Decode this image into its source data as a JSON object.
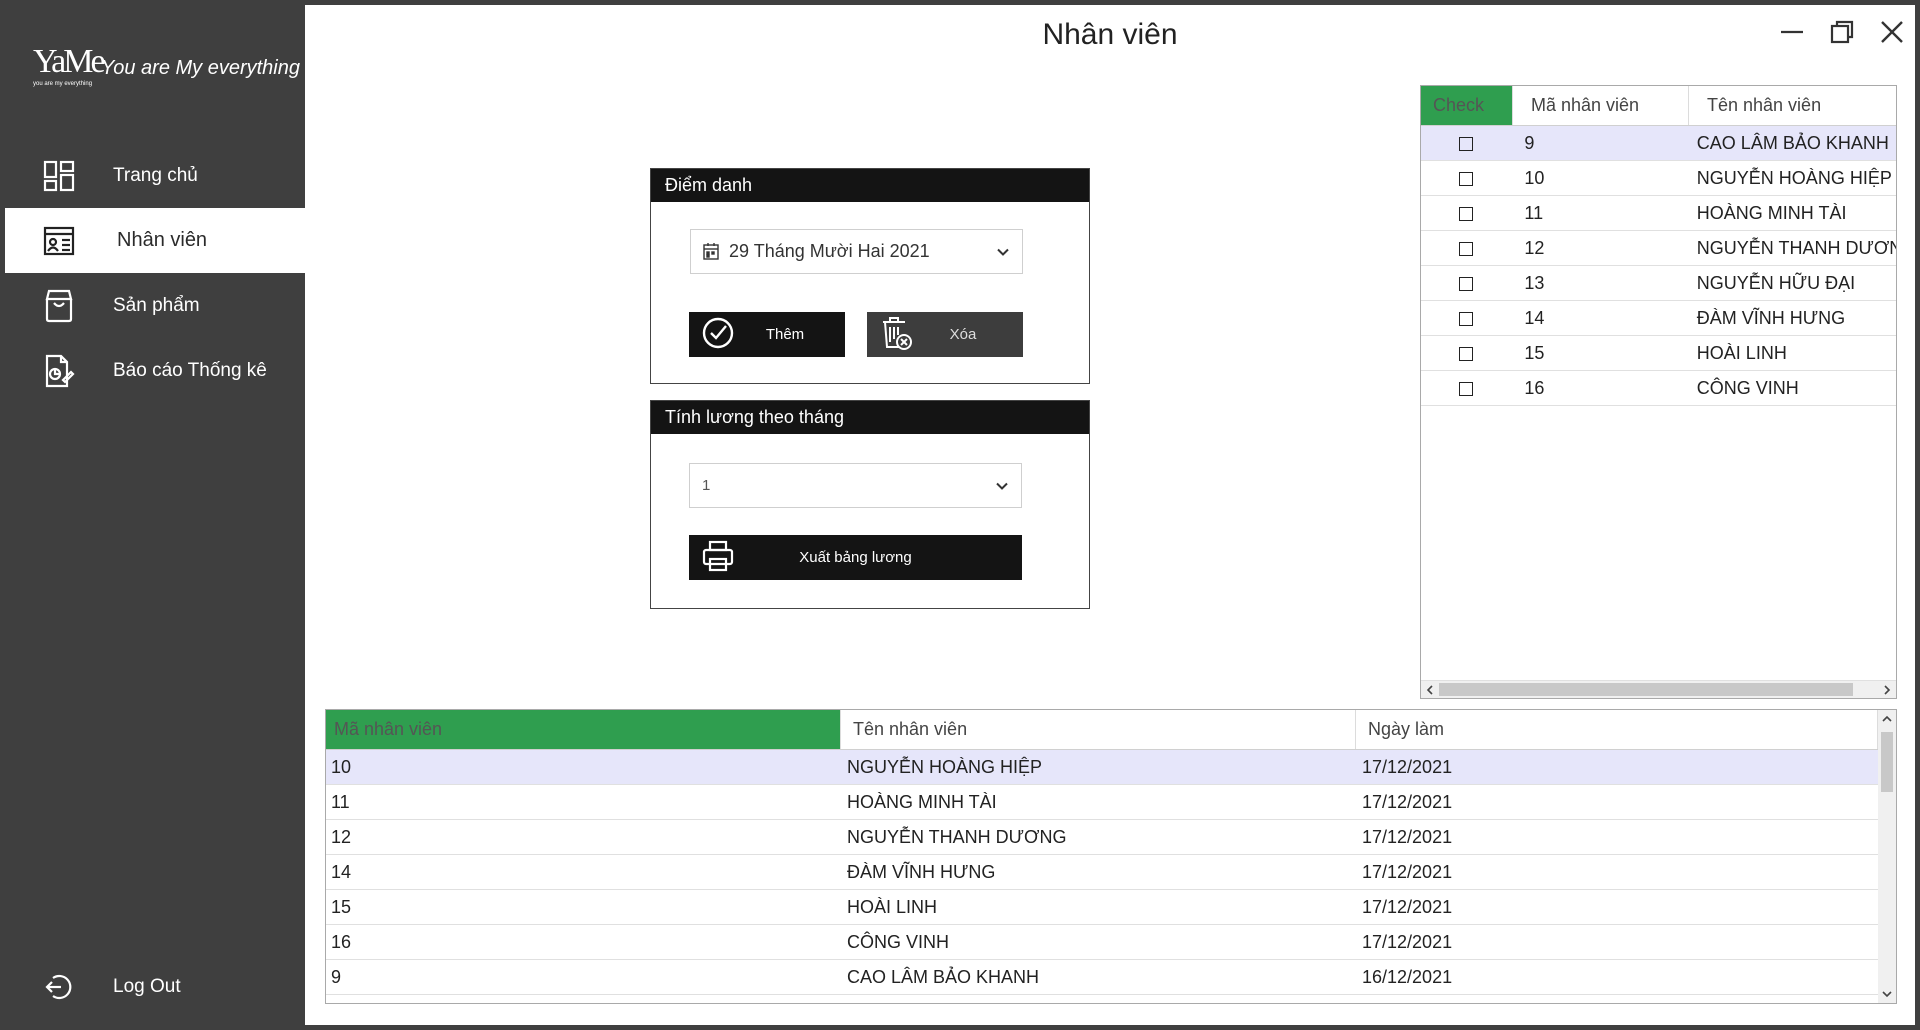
{
  "window": {
    "title": "Nhân viên"
  },
  "brand": {
    "logo_text": "YaMe",
    "logo_small": "you are my everything",
    "tagline": "You are My everything"
  },
  "sidebar": {
    "items": [
      {
        "label": "Trang chủ",
        "icon": "dashboard-icon",
        "active": false
      },
      {
        "label": "Nhân viên",
        "icon": "employee-card-icon",
        "active": true
      },
      {
        "label": "Sản phẩm",
        "icon": "product-bag-icon",
        "active": false
      },
      {
        "label": "Báo cáo Thống kê",
        "icon": "report-icon",
        "active": false
      }
    ],
    "logout": {
      "label": "Log Out",
      "icon": "logout-icon"
    }
  },
  "attendance": {
    "title": "Điểm danh",
    "date": "29 Tháng Mười Hai 2021",
    "add_label": "Thêm",
    "delete_label": "Xóa"
  },
  "salary": {
    "title": "Tính lương theo tháng",
    "month": "1",
    "export_label": "Xuất bảng lương"
  },
  "employee_grid": {
    "headers": [
      "Check",
      "Mã nhân viên",
      "Tên nhân viên"
    ],
    "rows": [
      {
        "id": "9",
        "name": "CAO LÂM BẢO KHANH",
        "selected": true
      },
      {
        "id": "10",
        "name": "NGUYỄN HOÀNG HIỆP",
        "selected": false
      },
      {
        "id": "11",
        "name": "HOÀNG MINH TÀI",
        "selected": false
      },
      {
        "id": "12",
        "name": "NGUYỄN THANH DƯƠNG",
        "selected": false
      },
      {
        "id": "13",
        "name": "NGUYỄN HỮU ĐẠI",
        "selected": false
      },
      {
        "id": "14",
        "name": "ĐÀM VĨNH HƯNG",
        "selected": false
      },
      {
        "id": "15",
        "name": "HOÀI LINH",
        "selected": false
      },
      {
        "id": "16",
        "name": "CÔNG VINH",
        "selected": false
      }
    ]
  },
  "attendance_grid": {
    "headers": [
      "Mã nhân viên",
      "Tên nhân viên",
      "Ngày làm"
    ],
    "rows": [
      {
        "id": "10",
        "name": "NGUYỄN HOÀNG HIỆP",
        "date": "17/12/2021",
        "selected": true
      },
      {
        "id": "11",
        "name": "HOÀNG MINH TÀI",
        "date": "17/12/2021",
        "selected": false
      },
      {
        "id": "12",
        "name": "NGUYỄN THANH DƯƠNG",
        "date": "17/12/2021",
        "selected": false
      },
      {
        "id": "14",
        "name": "ĐÀM VĨNH HƯNG",
        "date": "17/12/2021",
        "selected": false
      },
      {
        "id": "15",
        "name": "HOÀI LINH",
        "date": "17/12/2021",
        "selected": false
      },
      {
        "id": "16",
        "name": "CÔNG VINH",
        "date": "17/12/2021",
        "selected": false
      },
      {
        "id": "9",
        "name": "CAO LÂM BẢO KHANH",
        "date": "16/12/2021",
        "selected": false
      }
    ]
  },
  "colors": {
    "sidebar_bg": "#3f3f3f",
    "header_accent": "#2f9e4f",
    "selected_row": "#e6e6fa",
    "panel_head": "#141414"
  }
}
